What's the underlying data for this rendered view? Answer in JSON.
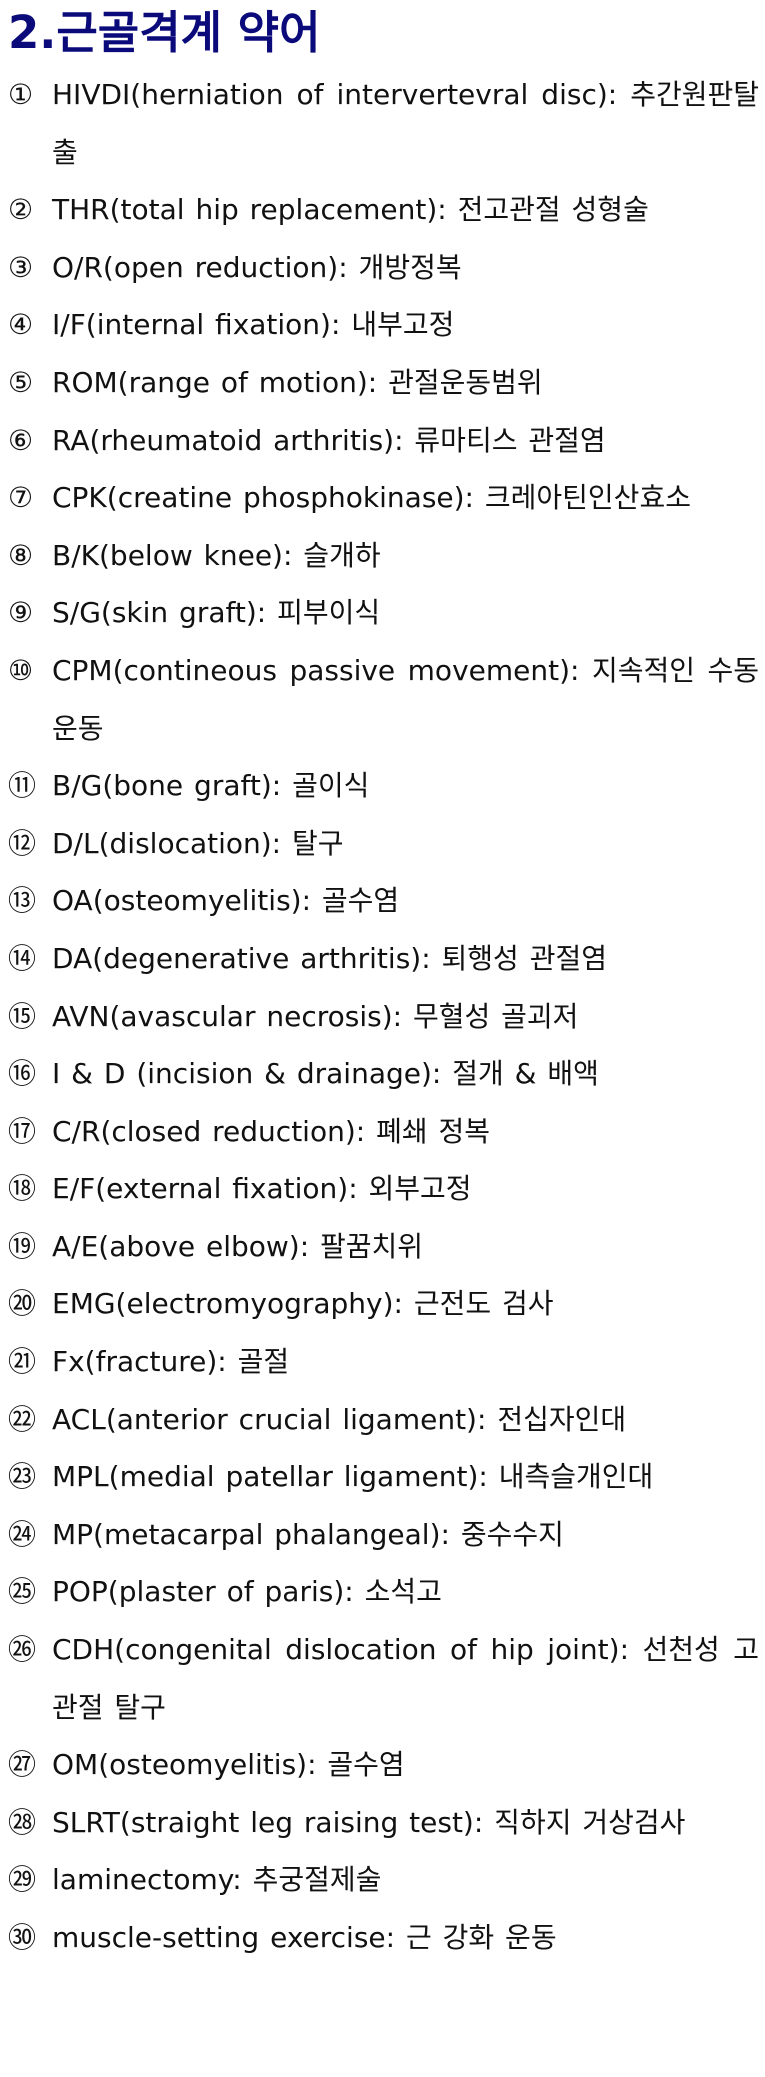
{
  "title": "2.근골격계 약어",
  "items": [
    {
      "num": "①",
      "text": "HIVDI(herniation of intervertevral disc): 추간원판탈출"
    },
    {
      "num": "②",
      "text": "THR(total hip replacement): 전고관절 성형술"
    },
    {
      "num": "③",
      "text": "O/R(open reduction): 개방정복"
    },
    {
      "num": "④",
      "text": "I/F(internal fixation): 내부고정"
    },
    {
      "num": "⑤",
      "text": "ROM(range of motion): 관절운동범위"
    },
    {
      "num": "⑥",
      "text": "RA(rheumatoid arthritis): 류마티스 관절염"
    },
    {
      "num": "⑦",
      "text": "CPK(creatine phosphokinase): 크레아틴인산효소"
    },
    {
      "num": "⑧",
      "text": "B/K(below knee): 슬개하"
    },
    {
      "num": "⑨",
      "text": "S/G(skin graft): 피부이식"
    },
    {
      "num": "⑩",
      "text": "CPM(contineous passive movement): 지속적인 수동운동"
    },
    {
      "num": "⑪",
      "text": "B/G(bone graft): 골이식"
    },
    {
      "num": "⑫",
      "text": "D/L(dislocation): 탈구"
    },
    {
      "num": "⑬",
      "text": "OA(osteomyelitis): 골수염"
    },
    {
      "num": "⑭",
      "text": "DA(degenerative arthritis): 퇴행성 관절염"
    },
    {
      "num": "⑮",
      "text": "AVN(avascular necrosis): 무혈성 골괴저"
    },
    {
      "num": "⑯",
      "text": "I & D (incision & drainage): 절개 & 배액"
    },
    {
      "num": "⑰",
      "text": "C/R(closed reduction): 폐쇄 정복"
    },
    {
      "num": "⑱",
      "text": "E/F(external fixation): 외부고정"
    },
    {
      "num": "⑲",
      "text": "A/E(above elbow): 팔꿈치위"
    },
    {
      "num": "⑳",
      "text": "EMG(electromyography): 근전도 검사"
    },
    {
      "num": "㉑",
      "text": "Fx(fracture): 골절"
    },
    {
      "num": "㉒",
      "text": "ACL(anterior crucial ligament): 전십자인대"
    },
    {
      "num": "㉓",
      "text": "MPL(medial patellar ligament): 내측슬개인대"
    },
    {
      "num": "㉔",
      "text": "MP(metacarpal phalangeal): 중수수지"
    },
    {
      "num": "㉕",
      "text": "POP(plaster of paris): 소석고"
    },
    {
      "num": "㉖",
      "text": "CDH(congenital dislocation of hip joint): 선천성 고관절 탈구"
    },
    {
      "num": "㉗",
      "text": "OM(osteomyelitis): 골수염"
    },
    {
      "num": "㉘",
      "text": "SLRT(straight leg raising test): 직하지 거상검사"
    },
    {
      "num": "㉙",
      "text": "laminectomy: 추궁절제술"
    },
    {
      "num": "㉚",
      "text": "muscle-setting exercise: 근 강화 운동"
    }
  ]
}
